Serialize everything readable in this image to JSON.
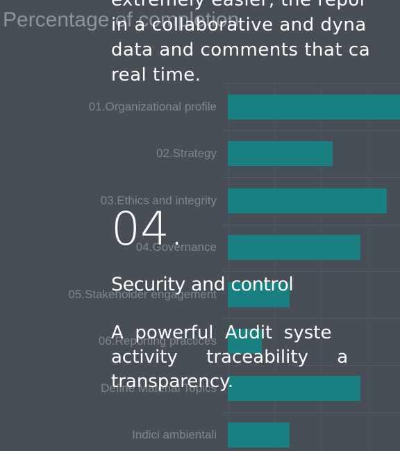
{
  "chart_data": {
    "type": "bar",
    "orientation": "horizontal",
    "title": "Percentage of completion",
    "categories": [
      "01.Organizational profile",
      "02.Strategy",
      "03.Ethics and integrity",
      "04.Governance",
      "05.Stakeholder engagement",
      "06.Reporting practices",
      "Define Material Topics",
      "Indici ambientali"
    ],
    "values": [
      92,
      56,
      85,
      71,
      33,
      18,
      71,
      33
    ],
    "xlim": [
      0,
      100
    ],
    "bar_color": "#1a7f80",
    "grid": true
  },
  "overlay": {
    "intro_lines": [
      "extremely easier, the repor",
      "in a collaborative and dyna",
      "data and comments that ca",
      "real time."
    ],
    "number": "04.",
    "title": "Security and control",
    "desc_lines": [
      "A  powerful  Audit  syste",
      "activity     traceability     a",
      "transparency."
    ]
  }
}
